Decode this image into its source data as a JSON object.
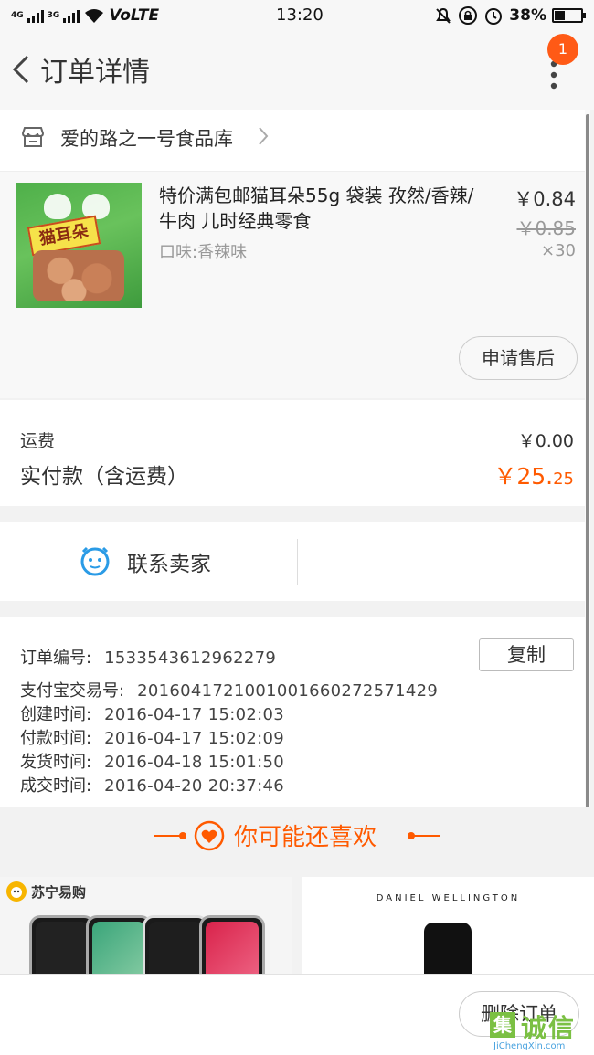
{
  "status_bar": {
    "network_1": "4G",
    "network_2": "3G",
    "volte": "VoLTE",
    "time": "13:20",
    "battery": "38%"
  },
  "nav": {
    "title": "订单详情",
    "badge": "1"
  },
  "store": {
    "name": "爱的路之一号食品库"
  },
  "product": {
    "title": "特价满包邮猫耳朵55g  袋装  孜然/香辣/牛肉 儿时经典零食",
    "spec": "口味:香辣味",
    "price_now": "￥0.84",
    "price_old": "￥0.85",
    "quantity": "×30",
    "image_label": "猫耳朵",
    "after_sale_label": "申请售后"
  },
  "fees": {
    "shipping_label": "运费",
    "shipping_value": "￥0.00",
    "paid_label": "实付款（含运费）",
    "paid_value_main": "￥25.",
    "paid_value_decimal": "25"
  },
  "contact": {
    "label": "联系卖家"
  },
  "order_info": {
    "order_no_label": "订单编号:",
    "order_no": "1533543612962279",
    "copy_label": "复制",
    "alipay_label": "支付宝交易号:",
    "alipay_no": "2016041721001001660272571429",
    "created_label": "创建时间:",
    "created": "2016-04-17  15:02:03",
    "paid_label": "付款时间:",
    "paid": "2016-04-17  15:02:09",
    "shipped_label": "发货时间:",
    "shipped": "2016-04-18  15:01:50",
    "done_label": "成交时间:",
    "done": "2016-04-20  20:37:46"
  },
  "recommend": {
    "title": "你可能还喜欢",
    "card_left_brand": "苏宁易购",
    "card_right_brand": "DANIEL WELLINGTON"
  },
  "bottom": {
    "delete_label": "删除订单"
  },
  "watermark": {
    "icon_char": "集",
    "text": "诚信",
    "sub": "JiChengXin.com"
  },
  "colors": {
    "accent": "#ff5a00",
    "badge": "#ff5a16",
    "contact_icon": "#2a9be6"
  }
}
